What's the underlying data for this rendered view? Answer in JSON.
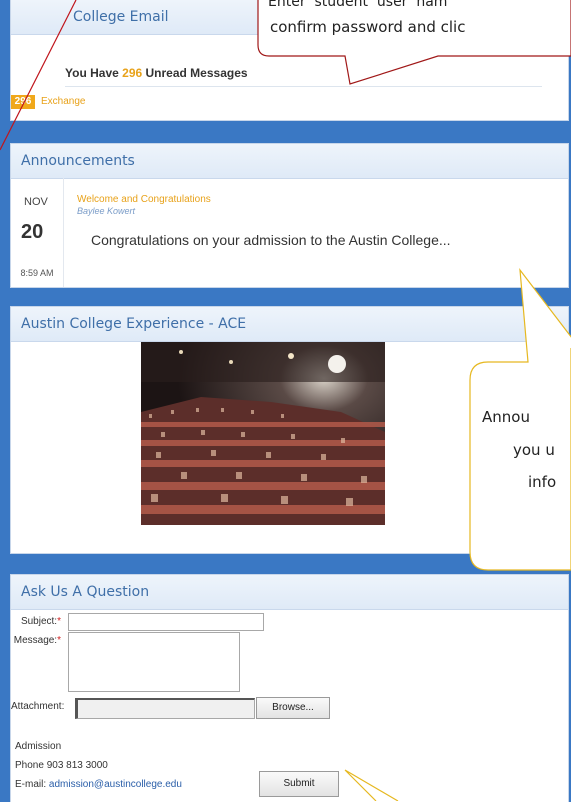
{
  "email": {
    "title": "College Email",
    "unread_prefix": "You Have ",
    "unread_count": "296",
    "unread_suffix": " Unread Messages",
    "exchange_badge": "296",
    "exchange_label": "Exchange"
  },
  "announcements": {
    "title": "Announcements",
    "month": "NOV",
    "day": "20",
    "time": "8:59 AM",
    "item_title": "Welcome and Congratulations",
    "author": "Baylee Kowert",
    "body": "Congratulations on your admission to the Austin College..."
  },
  "ace": {
    "title": "Austin College Experience - ACE"
  },
  "ask": {
    "title": "Ask Us A Question",
    "subject_label": "Subject:",
    "message_label": "Message:",
    "required_mark": "*",
    "attachment_label": "Attachment:",
    "browse_label": "Browse...",
    "contact_name": "Admission",
    "phone": "Phone 903 813 3000",
    "email_prefix": "E-mail: ",
    "email_address": "admission@austincollege.edu",
    "submit_label": "Submit"
  },
  "callouts": {
    "top_line1": "Enter  student  user  nam",
    "top_line2": "confirm password and clic",
    "ann_line1": "Annou",
    "ann_line2": "you u",
    "ann_line3": "info"
  }
}
